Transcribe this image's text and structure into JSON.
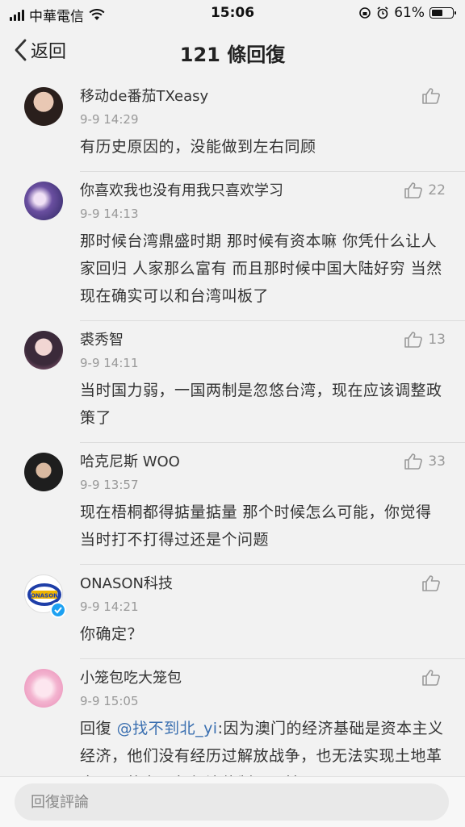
{
  "status_bar": {
    "carrier": "中華電信",
    "time": "15:06",
    "battery": "61%",
    "battery_level": 0.61
  },
  "nav": {
    "back_label": "返回",
    "title": "121 條回復"
  },
  "comments": [
    {
      "user": "移动de番茄TXeasy",
      "time": "9-9 14:29",
      "text": "有历史原因的，没能做到左右同顾",
      "likes": ""
    },
    {
      "user": "你喜欢我也没有用我只喜欢学习",
      "time": "9-9 14:13",
      "text": "那时候台湾鼎盛时期 那时候有资本嘛 你凭什么让人家回归 人家那么富有 而且那时候中国大陆好穷 当然现在确实可以和台湾叫板了",
      "likes": "22"
    },
    {
      "user": "裘秀智",
      "time": "9-9 14:11",
      "text": "当时国力弱，一国两制是忽悠台湾，现在应该调整政策了",
      "likes": "13"
    },
    {
      "user": "哈克尼斯 WOO",
      "time": "9-9 13:57",
      "text": "现在梧桐都得掂量掂量 那个时候怎么可能，你觉得当时打不打得过还是个问题",
      "likes": "33"
    },
    {
      "user": "ONASON科技",
      "time": "9-9 14:21",
      "text": "你确定？",
      "likes": "",
      "avatar_text": "ONASON"
    },
    {
      "user": "小笼包吃大笼包",
      "time": "9-9 15:05",
      "reply_prefix": "回復",
      "mention": "@找不到北_yi",
      "text": ":因为澳门的经济基础是资本主义经济，他们没有经历过解放战争，也无法实现土地革命，只能在现行经济体制下运转",
      "likes": ""
    }
  ],
  "input": {
    "placeholder": "回復評論"
  },
  "icons": {
    "back": "chevron-left-icon",
    "like": "thumbs-up-icon",
    "wifi": "wifi-icon",
    "verified": "verified-badge-icon"
  }
}
